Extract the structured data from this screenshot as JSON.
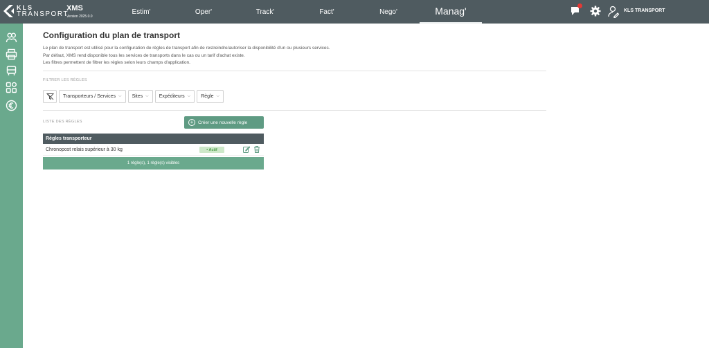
{
  "header": {
    "logo_line1": "KLS",
    "logo_line2": "TRANSPORT",
    "app_name": "XMS",
    "app_version": "Version 2025.0.0",
    "nav": [
      {
        "label": "Estim'"
      },
      {
        "label": "Oper'"
      },
      {
        "label": "Track'"
      },
      {
        "label": "Fact'"
      },
      {
        "label": "Nego'"
      },
      {
        "label": "Manag'",
        "active": true
      }
    ],
    "user_name": "KLS TRANSPORT",
    "icons": [
      "chat-icon",
      "gear-icon",
      "user-edit-icon"
    ],
    "notification_color": "#e53935"
  },
  "sidebar": {
    "items": [
      {
        "icon": "people-icon"
      },
      {
        "icon": "printer-icon"
      },
      {
        "icon": "truck-icon"
      },
      {
        "icon": "modules-icon"
      },
      {
        "icon": "euro-icon"
      }
    ]
  },
  "page": {
    "title": "Configuration du plan de transport",
    "desc_lines": [
      "Le plan de transport est utilisé pour la configuration de règles de transport afin de restreindre/autoriser la disponibilité d'un ou plusieurs services.",
      "Par défaut, XMS rend disponible tous les services de transports dans le cas ou un tarif d'achat existe.",
      "Les filtres permettent de filtrer les règles selon leurs champs d'application."
    ],
    "filter_section_label": "FILTRER LES RÈGLES",
    "filters": [
      {
        "label": "Transporteurs / Services"
      },
      {
        "label": "Sites"
      },
      {
        "label": "Expéditeurs"
      },
      {
        "label": "Règle"
      }
    ],
    "rules_section_label": "LISTE DES RÈGLES",
    "create_button": "Créer une nouvelle règle",
    "table": {
      "header": "Règles transporteur",
      "rows": [
        {
          "name": "Chronopost relais supérieur à 30 kg",
          "status": "• Actif"
        }
      ],
      "footer": "1 règle(s), 1 règle(s) visibles"
    }
  },
  "colors": {
    "topbar": "#4f5b60",
    "sidebar": "#6aa98d",
    "accent": "#5f9b83",
    "badge_bg": "#cde8c9",
    "badge_text": "#4a9a45"
  }
}
